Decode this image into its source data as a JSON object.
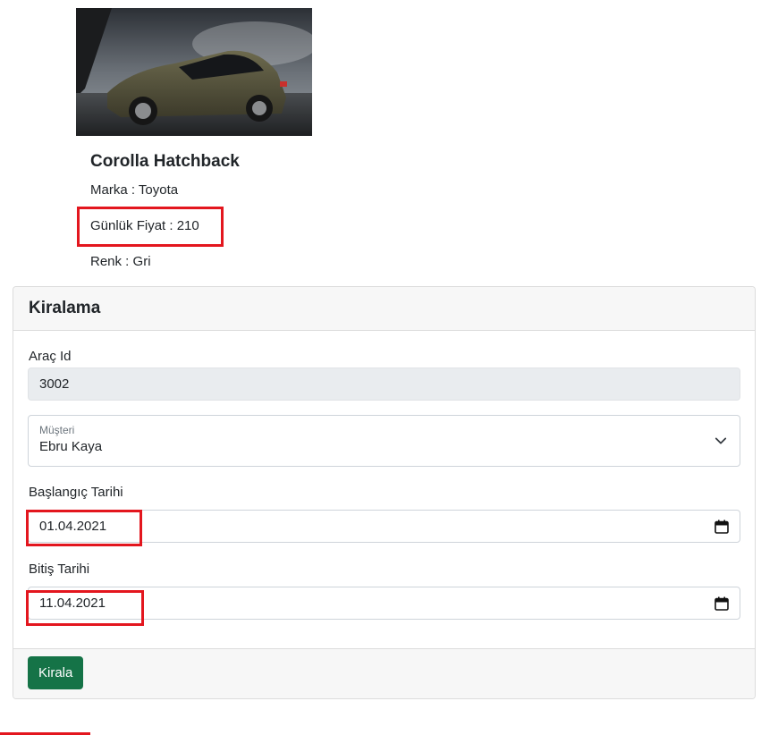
{
  "car": {
    "image_alt": "Corolla Hatchback",
    "title": "Corolla Hatchback",
    "brand_label": "Marka : ",
    "brand_value": "Toyota",
    "price_label": "Günlük Fiyat : ",
    "price_value": "210",
    "color_label": "Renk : ",
    "color_value": "Gri"
  },
  "rental_form": {
    "header": "Kiralama",
    "car_id_label": "Araç Id",
    "car_id_value": "3002",
    "customer_label": "Müşteri",
    "customer_value": "Ebru Kaya",
    "start_date_label": "Başlangıç Tarihi",
    "start_date_value": "01.04.2021",
    "end_date_label": "Bitiş Tarihi",
    "end_date_value": "11.04.2021",
    "submit_label": "Kirala"
  },
  "colors": {
    "highlight": "#e3161e",
    "primary_button": "#157347",
    "readonly_bg": "#e9ecef"
  }
}
